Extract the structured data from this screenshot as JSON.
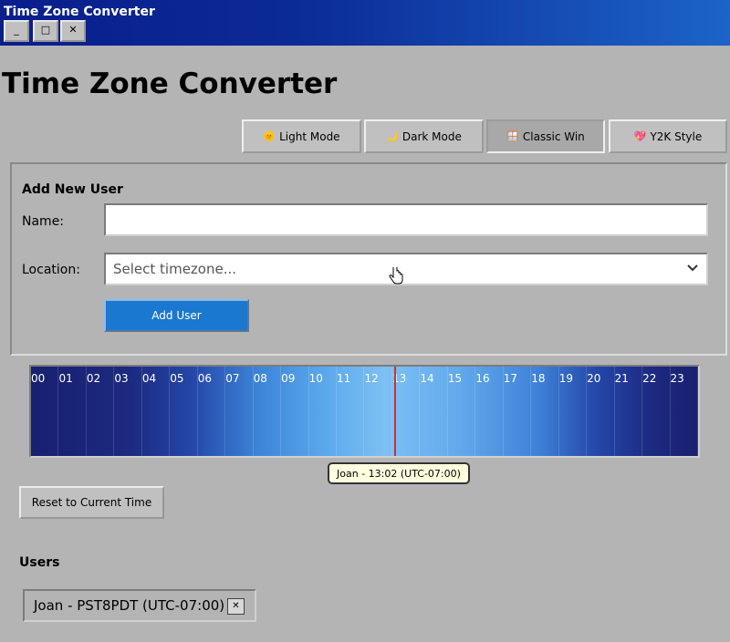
{
  "window": {
    "title": "Time Zone Converter",
    "controls": {
      "minimize": "_",
      "maximize": "□",
      "close": "✕"
    }
  },
  "page_title": "Time Zone Converter",
  "themes": [
    {
      "icon": "🌞",
      "label": "Light Mode"
    },
    {
      "icon": "🌙",
      "label": "Dark Mode"
    },
    {
      "icon": "🪟",
      "label": "Classic Win"
    },
    {
      "icon": "💖",
      "label": "Y2K Style"
    }
  ],
  "add_user": {
    "heading": "Add New User",
    "name_label": "Name:",
    "name_value": "",
    "location_label": "Location:",
    "location_placeholder": "Select timezone...",
    "button": "Add User"
  },
  "timeline": {
    "hours": [
      "00",
      "01",
      "02",
      "03",
      "04",
      "05",
      "06",
      "07",
      "08",
      "09",
      "10",
      "11",
      "12",
      "13",
      "14",
      "15",
      "16",
      "17",
      "18",
      "19",
      "20",
      "21",
      "22",
      "23"
    ],
    "tooltip": "Joan - 13:02 (UTC-07:00)"
  },
  "reset_button": "Reset to Current Time",
  "users": {
    "heading": "Users",
    "list": [
      {
        "label": "Joan - PST8PDT (UTC-07:00)",
        "remove": "✕"
      }
    ]
  }
}
